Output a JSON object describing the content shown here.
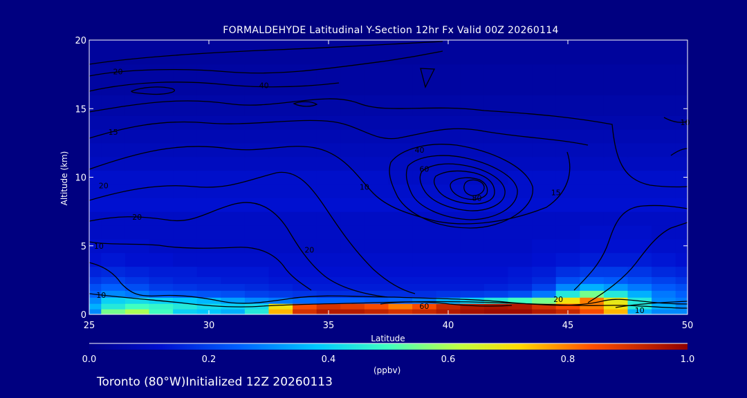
{
  "chart_data": {
    "type": "heatmap",
    "title": "FORMALDEHYDE Latitudinal Y-Section 12hr  Fx Valid 00Z 20260114",
    "xlabel": "Latitude",
    "ylabel": "Altitude (km)",
    "xlim": [
      25,
      50
    ],
    "ylim": [
      0,
      20
    ],
    "x_ticks": [
      "25",
      "30",
      "35",
      "40",
      "45",
      "50"
    ],
    "y_ticks": [
      "0",
      "5",
      "10",
      "15",
      "20"
    ],
    "colorbar": {
      "units": "(ppbv)",
      "range": [
        0.0,
        1.0
      ],
      "ticks": [
        "0.0",
        "0.2",
        "0.4",
        "0.6",
        "0.8",
        "1.0"
      ]
    },
    "field": {
      "description_free": true,
      "lat": [
        25,
        26,
        27,
        28,
        29,
        30,
        31,
        32,
        33,
        34,
        35,
        36,
        37,
        38,
        39,
        40,
        41,
        42,
        43,
        44,
        45,
        46,
        47,
        48,
        49,
        50
      ],
      "alt": [
        0.2,
        0.6,
        1.0,
        1.5,
        2.0,
        2.5,
        3.0,
        4.0,
        5.0,
        6.0,
        7.0,
        8.0,
        9.0,
        10.0,
        11.0,
        12.0,
        13.0,
        14.0,
        15.0,
        17.0,
        19.5
      ],
      "values": [
        [
          0.3,
          0.55,
          0.6,
          0.5,
          0.4,
          0.38,
          0.35,
          0.45,
          0.75,
          0.9,
          0.95,
          0.95,
          0.93,
          0.9,
          0.92,
          0.95,
          0.97,
          0.98,
          0.98,
          0.95,
          0.92,
          0.85,
          0.75,
          0.35,
          0.3,
          0.3
        ],
        [
          0.35,
          0.45,
          0.5,
          0.48,
          0.45,
          0.42,
          0.4,
          0.42,
          0.7,
          0.85,
          0.9,
          0.88,
          0.85,
          0.8,
          0.85,
          0.92,
          0.95,
          0.96,
          0.95,
          0.9,
          0.85,
          0.8,
          0.7,
          0.45,
          0.35,
          0.3
        ],
        [
          0.3,
          0.4,
          0.42,
          0.4,
          0.38,
          0.36,
          0.33,
          0.3,
          0.28,
          0.26,
          0.25,
          0.25,
          0.24,
          0.25,
          0.28,
          0.35,
          0.4,
          0.45,
          0.5,
          0.55,
          0.7,
          0.8,
          0.68,
          0.45,
          0.3,
          0.28
        ],
        [
          0.25,
          0.3,
          0.28,
          0.25,
          0.24,
          0.23,
          0.22,
          0.2,
          0.19,
          0.18,
          0.17,
          0.17,
          0.17,
          0.17,
          0.17,
          0.18,
          0.19,
          0.2,
          0.22,
          0.28,
          0.45,
          0.55,
          0.45,
          0.35,
          0.28,
          0.25
        ],
        [
          0.22,
          0.25,
          0.22,
          0.19,
          0.18,
          0.17,
          0.17,
          0.16,
          0.15,
          0.14,
          0.14,
          0.14,
          0.14,
          0.14,
          0.14,
          0.14,
          0.14,
          0.15,
          0.16,
          0.2,
          0.3,
          0.35,
          0.32,
          0.28,
          0.24,
          0.22
        ],
        [
          0.18,
          0.2,
          0.18,
          0.16,
          0.15,
          0.15,
          0.14,
          0.14,
          0.13,
          0.13,
          0.13,
          0.13,
          0.13,
          0.13,
          0.13,
          0.13,
          0.13,
          0.13,
          0.14,
          0.16,
          0.22,
          0.25,
          0.24,
          0.22,
          0.2,
          0.18
        ],
        [
          0.15,
          0.16,
          0.15,
          0.14,
          0.14,
          0.13,
          0.13,
          0.13,
          0.12,
          0.12,
          0.12,
          0.12,
          0.12,
          0.12,
          0.12,
          0.12,
          0.12,
          0.12,
          0.13,
          0.14,
          0.17,
          0.19,
          0.19,
          0.18,
          0.16,
          0.15
        ],
        [
          0.12,
          0.13,
          0.12,
          0.12,
          0.11,
          0.11,
          0.11,
          0.11,
          0.11,
          0.11,
          0.11,
          0.11,
          0.11,
          0.11,
          0.11,
          0.11,
          0.11,
          0.11,
          0.11,
          0.12,
          0.13,
          0.14,
          0.14,
          0.14,
          0.13,
          0.12
        ],
        [
          0.11,
          0.11,
          0.11,
          0.1,
          0.1,
          0.1,
          0.1,
          0.1,
          0.1,
          0.1,
          0.1,
          0.1,
          0.1,
          0.1,
          0.1,
          0.1,
          0.1,
          0.1,
          0.1,
          0.11,
          0.11,
          0.12,
          0.12,
          0.12,
          0.11,
          0.11
        ],
        [
          0.1,
          0.1,
          0.1,
          0.1,
          0.1,
          0.1,
          0.1,
          0.1,
          0.1,
          0.1,
          0.1,
          0.1,
          0.1,
          0.1,
          0.1,
          0.1,
          0.1,
          0.1,
          0.1,
          0.1,
          0.1,
          0.11,
          0.11,
          0.11,
          0.1,
          0.1
        ],
        [
          0.1,
          0.1,
          0.1,
          0.1,
          0.1,
          0.1,
          0.1,
          0.1,
          0.1,
          0.1,
          0.1,
          0.1,
          0.1,
          0.1,
          0.1,
          0.1,
          0.1,
          0.1,
          0.1,
          0.1,
          0.1,
          0.1,
          0.1,
          0.1,
          0.1,
          0.1
        ],
        [
          0.12,
          0.12,
          0.12,
          0.12,
          0.12,
          0.12,
          0.12,
          0.12,
          0.12,
          0.12,
          0.12,
          0.12,
          0.12,
          0.12,
          0.12,
          0.12,
          0.12,
          0.12,
          0.12,
          0.12,
          0.12,
          0.12,
          0.12,
          0.12,
          0.12,
          0.12
        ],
        [
          0.11,
          0.11,
          0.11,
          0.11,
          0.11,
          0.11,
          0.11,
          0.11,
          0.11,
          0.11,
          0.11,
          0.11,
          0.11,
          0.11,
          0.11,
          0.11,
          0.11,
          0.11,
          0.11,
          0.11,
          0.11,
          0.11,
          0.11,
          0.11,
          0.11,
          0.11
        ],
        [
          0.11,
          0.11,
          0.11,
          0.11,
          0.11,
          0.11,
          0.11,
          0.11,
          0.11,
          0.11,
          0.11,
          0.11,
          0.11,
          0.1,
          0.1,
          0.1,
          0.1,
          0.1,
          0.11,
          0.11,
          0.11,
          0.11,
          0.11,
          0.11,
          0.11,
          0.11
        ],
        [
          0.09,
          0.09,
          0.09,
          0.09,
          0.09,
          0.09,
          0.09,
          0.09,
          0.09,
          0.09,
          0.09,
          0.09,
          0.09,
          0.09,
          0.09,
          0.09,
          0.09,
          0.09,
          0.09,
          0.09,
          0.09,
          0.09,
          0.09,
          0.09,
          0.09,
          0.09
        ],
        [
          0.08,
          0.08,
          0.08,
          0.08,
          0.08,
          0.08,
          0.08,
          0.08,
          0.08,
          0.08,
          0.08,
          0.08,
          0.08,
          0.08,
          0.08,
          0.08,
          0.08,
          0.08,
          0.08,
          0.08,
          0.08,
          0.08,
          0.08,
          0.08,
          0.08,
          0.08
        ],
        [
          0.07,
          0.07,
          0.07,
          0.07,
          0.07,
          0.07,
          0.07,
          0.07,
          0.07,
          0.07,
          0.07,
          0.07,
          0.07,
          0.07,
          0.07,
          0.07,
          0.07,
          0.07,
          0.07,
          0.07,
          0.07,
          0.07,
          0.07,
          0.07,
          0.07,
          0.07
        ],
        [
          0.06,
          0.06,
          0.06,
          0.06,
          0.06,
          0.06,
          0.06,
          0.06,
          0.06,
          0.06,
          0.06,
          0.06,
          0.06,
          0.06,
          0.06,
          0.06,
          0.06,
          0.06,
          0.06,
          0.06,
          0.06,
          0.06,
          0.06,
          0.06,
          0.06,
          0.06
        ],
        [
          0.05,
          0.05,
          0.05,
          0.05,
          0.05,
          0.05,
          0.05,
          0.05,
          0.05,
          0.05,
          0.05,
          0.05,
          0.05,
          0.05,
          0.05,
          0.05,
          0.05,
          0.05,
          0.05,
          0.05,
          0.05,
          0.05,
          0.05,
          0.05,
          0.05,
          0.05
        ],
        [
          0.04,
          0.04,
          0.04,
          0.04,
          0.04,
          0.04,
          0.04,
          0.04,
          0.04,
          0.04,
          0.04,
          0.04,
          0.04,
          0.04,
          0.04,
          0.04,
          0.04,
          0.04,
          0.04,
          0.04,
          0.04,
          0.04,
          0.04,
          0.04,
          0.04,
          0.04
        ],
        [
          0.03,
          0.03,
          0.03,
          0.03,
          0.03,
          0.03,
          0.03,
          0.03,
          0.03,
          0.03,
          0.03,
          0.03,
          0.03,
          0.03,
          0.03,
          0.03,
          0.03,
          0.03,
          0.03,
          0.03,
          0.03,
          0.03,
          0.03,
          0.03,
          0.03,
          0.03
        ]
      ]
    },
    "contour_labels": [
      {
        "text": "20",
        "lat": 26.2,
        "alt": 17.7
      },
      {
        "text": "20",
        "lat": 27.0,
        "alt": 7.1
      },
      {
        "text": "40",
        "lat": 32.3,
        "alt": 16.7
      },
      {
        "text": "15",
        "lat": 26.0,
        "alt": 13.3
      },
      {
        "text": "20",
        "lat": 25.6,
        "alt": 9.4
      },
      {
        "text": "10",
        "lat": 25.4,
        "alt": 5.0
      },
      {
        "text": "40",
        "lat": 38.8,
        "alt": 12.0
      },
      {
        "text": "60",
        "lat": 39.0,
        "alt": 10.6
      },
      {
        "text": "80",
        "lat": 41.2,
        "alt": 8.5
      },
      {
        "text": "15",
        "lat": 44.5,
        "alt": 8.9
      },
      {
        "text": "10",
        "lat": 36.5,
        "alt": 9.3
      },
      {
        "text": "20",
        "lat": 34.2,
        "alt": 4.7
      },
      {
        "text": "20",
        "lat": 44.6,
        "alt": 1.1
      },
      {
        "text": "60",
        "lat": 39.0,
        "alt": 0.6
      },
      {
        "text": "10",
        "lat": 48.0,
        "alt": 0.3
      },
      {
        "text": "10",
        "lat": 25.5,
        "alt": 1.4
      },
      {
        "text": "10",
        "lat": 49.9,
        "alt": 14.0
      }
    ]
  },
  "footer": "Toronto (80°W)Initialized 12Z 20260113",
  "colors": {
    "background": "#000080",
    "axis": "#ffffff",
    "contour": "#000000"
  }
}
